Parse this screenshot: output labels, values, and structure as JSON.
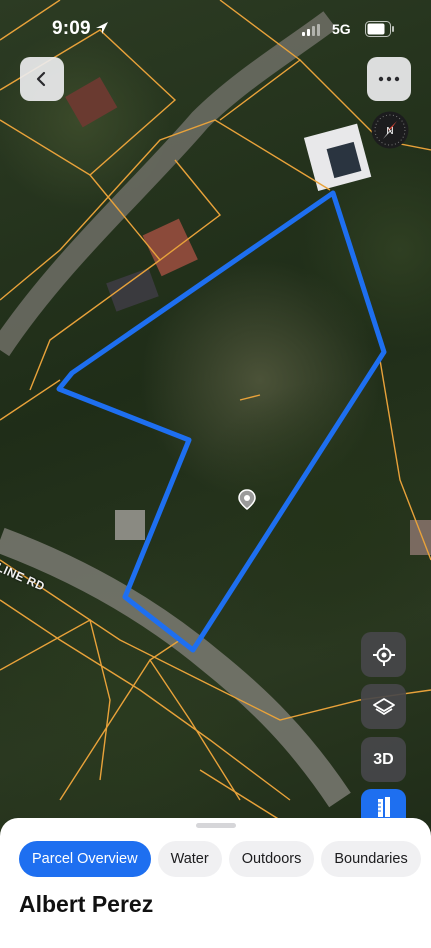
{
  "status_bar": {
    "time": "9:09",
    "network": "5G",
    "icons": [
      "location-arrow-icon",
      "signal-icon",
      "battery-icon"
    ]
  },
  "map": {
    "road_label": "LINE RD",
    "compass_letter": "N",
    "accent_color": "#1e6ff0",
    "parcel_line_color": "#e8a23a"
  },
  "controls": {
    "three_d_label": "3D",
    "icons": [
      "back-icon",
      "more-icon",
      "compass-icon",
      "locate-icon",
      "layers-icon",
      "measure-icon"
    ]
  },
  "sheet": {
    "tabs": [
      {
        "label": "Parcel Overview",
        "active": true
      },
      {
        "label": "Water",
        "active": false
      },
      {
        "label": "Outdoors",
        "active": false
      },
      {
        "label": "Boundaries",
        "active": false
      }
    ],
    "owner_name": "Albert Perez"
  }
}
